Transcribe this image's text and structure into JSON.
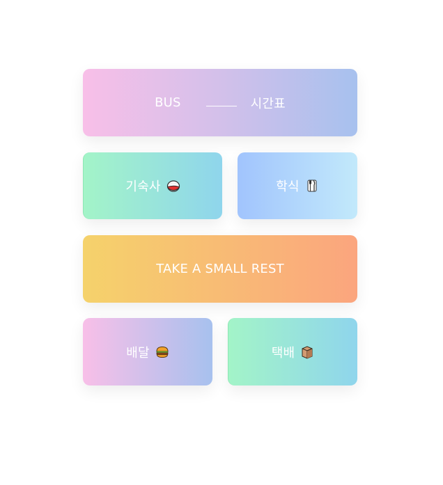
{
  "menu": {
    "bus": {
      "label_left": "BUS",
      "label_right": "시간표"
    },
    "dorm": {
      "label": "기숙사",
      "icon": "rice-ball-icon"
    },
    "cafeteria": {
      "label": "학식",
      "icon": "fork-knife-icon"
    },
    "rest": {
      "label": "TAKE A SMALL REST"
    },
    "delivery": {
      "label": "배달",
      "icon": "burger-icon"
    },
    "parcel": {
      "label": "택배",
      "icon": "package-icon"
    }
  },
  "colors": {
    "pink": "#f8bfe8",
    "blue": "#a7c1ee",
    "mint": "#a3f4c8",
    "sky": "#8fd5ec",
    "yellow": "#f5d26b",
    "salmon": "#fba57e"
  }
}
